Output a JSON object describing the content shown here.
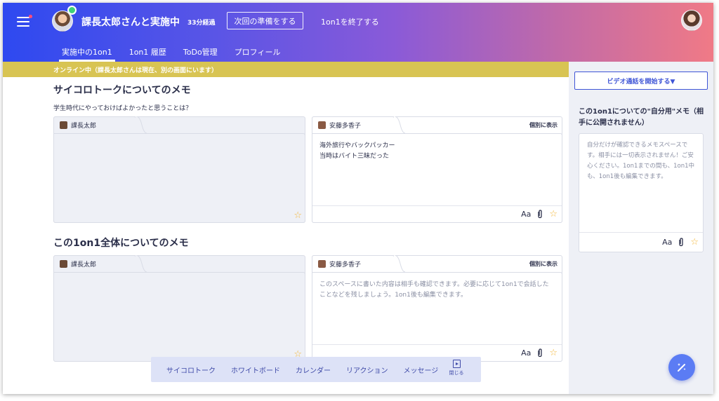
{
  "header": {
    "title": "課長太郎さんと実施中",
    "elapsed": "33分経過",
    "prepare_button": "次回の準備をする",
    "end_button": "1on1を終了する",
    "tabs": [
      {
        "label": "実施中の1on1",
        "active": true
      },
      {
        "label": "1on1 履歴"
      },
      {
        "label": "ToDo管理"
      },
      {
        "label": "プロフィール"
      }
    ]
  },
  "banner": "オンライン中（課長太郎さんは現在、別の画面にいます）",
  "sections": [
    {
      "title": "サイコロトークについてのメモ",
      "question": "学生時代にやっておけばよかったと思うことは？",
      "left_name": "課長太郎",
      "right_name": "安藤多香子",
      "show_individual": "個別に表示",
      "right_text": "海外旅行やバックパッカー\n当時はバイト三昧だった"
    },
    {
      "title": "この1on1全体についてのメモ",
      "left_name": "課長太郎",
      "right_name": "安藤多香子",
      "show_individual": "個別に表示",
      "right_placeholder": "このスペースに書いた内容は相手も確認できます。必要に応じて1on1で会話したことなどを残しましょう。1on1後も編集できます。"
    }
  ],
  "side": {
    "video_button": "ビデオ通話を開始する▼",
    "title": "この1on1についての\"自分用\"メモ（相手に公開されません）",
    "placeholder": "自分だけが確認できるメモスペースです。相手には一切表示されません！ご安心ください。1on1までの間も、1on1中も、1on1後も編集できます。"
  },
  "icons": {
    "font": "Aa",
    "star": "☆",
    "clip": "📎"
  },
  "toolbar": {
    "items": [
      "サイコロトーク",
      "ホワイトボード",
      "カレンダー",
      "リアクション",
      "メッセージ"
    ],
    "close_label": "閉じる"
  },
  "colors": {
    "brand_blue": "#2e49f0",
    "gradient_end": "#f07a86",
    "banner": "#d8c453",
    "accent": "#3f55d6",
    "star": "#f4b73a"
  }
}
